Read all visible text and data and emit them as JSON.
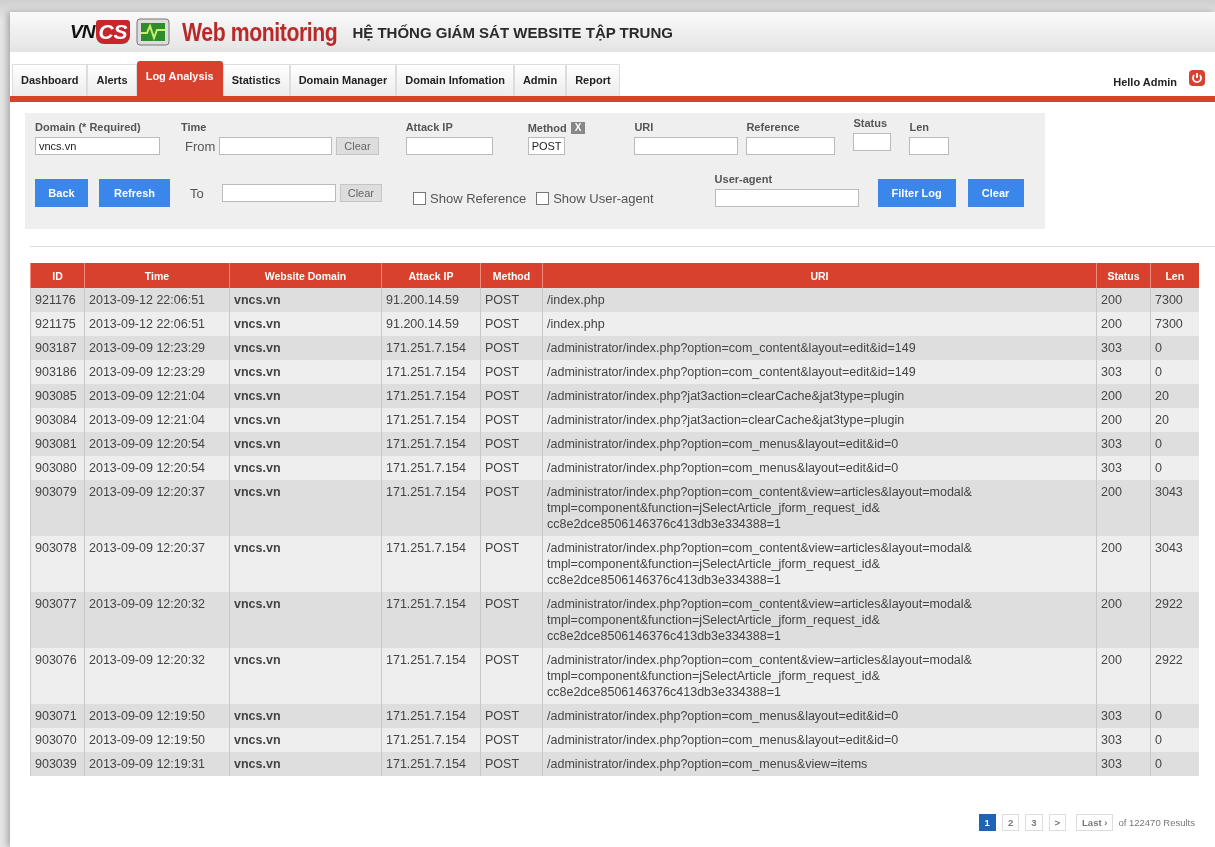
{
  "header": {
    "logo_left": "VN",
    "logo_right": "CS",
    "brand": "Web monitoring",
    "title": "HỆ THỐNG GIÁM SÁT WEBSITE TẬP TRUNG"
  },
  "tabs": [
    {
      "label": "Dashboard",
      "selected": false
    },
    {
      "label": "Alerts",
      "selected": false
    },
    {
      "label": "Log Analysis",
      "selected": true
    },
    {
      "label": "Statistics",
      "selected": false
    },
    {
      "label": "Domain Manager",
      "selected": false
    },
    {
      "label": "Domain Infomation",
      "selected": false
    },
    {
      "label": "Admin",
      "selected": false
    },
    {
      "label": "Report",
      "selected": false
    }
  ],
  "user": {
    "greeting": "Hello Admin"
  },
  "filter": {
    "domain": {
      "label": "Domain (* Required)",
      "value": "vncs.vn"
    },
    "time": {
      "label": "Time",
      "from_label": "From",
      "from_clear": "Clear",
      "to_label": "To",
      "to_clear": "Clear"
    },
    "attack_ip": {
      "label": "Attack IP"
    },
    "method": {
      "label": "Method",
      "clear": "X",
      "value": "POST"
    },
    "uri": {
      "label": "URI"
    },
    "reference": {
      "label": "Reference"
    },
    "status": {
      "label": "Status"
    },
    "len": {
      "label": "Len"
    },
    "user_agent": {
      "label": "User-agent"
    },
    "checkboxes": [
      {
        "label": "Show Reference",
        "checked": false
      },
      {
        "label": "Show User-agent",
        "checked": false
      }
    ],
    "buttons": {
      "back": "Back",
      "refresh": "Refresh",
      "filter_log": "Filter Log",
      "clear": "Clear"
    }
  },
  "table": {
    "columns": [
      "ID",
      "Time",
      "Website Domain",
      "Attack IP",
      "Method",
      "URI",
      "Status",
      "Len"
    ],
    "rows": [
      [
        "921176",
        "2013-09-12 22:06:51",
        "vncs.vn",
        "91.200.14.59",
        "POST",
        "/index.php",
        "200",
        "7300"
      ],
      [
        "921175",
        "2013-09-12 22:06:51",
        "vncs.vn",
        "91.200.14.59",
        "POST",
        "/index.php",
        "200",
        "7300"
      ],
      [
        "903187",
        "2013-09-09 12:23:29",
        "vncs.vn",
        "171.251.7.154",
        "POST",
        "/administrator/index.php?option=com_content&layout=edit&id=149",
        "303",
        "0"
      ],
      [
        "903186",
        "2013-09-09 12:23:29",
        "vncs.vn",
        "171.251.7.154",
        "POST",
        "/administrator/index.php?option=com_content&layout=edit&id=149",
        "303",
        "0"
      ],
      [
        "903085",
        "2013-09-09 12:21:04",
        "vncs.vn",
        "171.251.7.154",
        "POST",
        "/administrator/index.php?jat3action=clearCache&jat3type=plugin",
        "200",
        "20"
      ],
      [
        "903084",
        "2013-09-09 12:21:04",
        "vncs.vn",
        "171.251.7.154",
        "POST",
        "/administrator/index.php?jat3action=clearCache&jat3type=plugin",
        "200",
        "20"
      ],
      [
        "903081",
        "2013-09-09 12:20:54",
        "vncs.vn",
        "171.251.7.154",
        "POST",
        "/administrator/index.php?option=com_menus&layout=edit&id=0",
        "303",
        "0"
      ],
      [
        "903080",
        "2013-09-09 12:20:54",
        "vncs.vn",
        "171.251.7.154",
        "POST",
        "/administrator/index.php?option=com_menus&layout=edit&id=0",
        "303",
        "0"
      ],
      [
        "903079",
        "2013-09-09 12:20:37",
        "vncs.vn",
        "171.251.7.154",
        "POST",
        "/administrator/index.php?option=com_content&view=articles&layout=modal& tmpl=component&function=jSelectArticle_jform_request_id& cc8e2dce8506146376c413db3e334388=1",
        "200",
        "3043"
      ],
      [
        "903078",
        "2013-09-09 12:20:37",
        "vncs.vn",
        "171.251.7.154",
        "POST",
        "/administrator/index.php?option=com_content&view=articles&layout=modal& tmpl=component&function=jSelectArticle_jform_request_id& cc8e2dce8506146376c413db3e334388=1",
        "200",
        "3043"
      ],
      [
        "903077",
        "2013-09-09 12:20:32",
        "vncs.vn",
        "171.251.7.154",
        "POST",
        "/administrator/index.php?option=com_content&view=articles&layout=modal& tmpl=component&function=jSelectArticle_jform_request_id& cc8e2dce8506146376c413db3e334388=1",
        "200",
        "2922"
      ],
      [
        "903076",
        "2013-09-09 12:20:32",
        "vncs.vn",
        "171.251.7.154",
        "POST",
        "/administrator/index.php?option=com_content&view=articles&layout=modal& tmpl=component&function=jSelectArticle_jform_request_id& cc8e2dce8506146376c413db3e334388=1",
        "200",
        "2922"
      ],
      [
        "903071",
        "2013-09-09 12:19:50",
        "vncs.vn",
        "171.251.7.154",
        "POST",
        "/administrator/index.php?option=com_menus&layout=edit&id=0",
        "303",
        "0"
      ],
      [
        "903070",
        "2013-09-09 12:19:50",
        "vncs.vn",
        "171.251.7.154",
        "POST",
        "/administrator/index.php?option=com_menus&layout=edit&id=0",
        "303",
        "0"
      ],
      [
        "903039",
        "2013-09-09 12:19:31",
        "vncs.vn",
        "171.251.7.154",
        "POST",
        "/administrator/index.php?option=com_menus&view=items",
        "303",
        "0"
      ]
    ]
  },
  "pagination": {
    "pages": [
      {
        "label": "1",
        "selected": true
      },
      {
        "label": "2",
        "selected": false
      },
      {
        "label": "3",
        "selected": false
      }
    ],
    "next": ">",
    "last": "Last ›",
    "results": "of 122470 Results"
  }
}
